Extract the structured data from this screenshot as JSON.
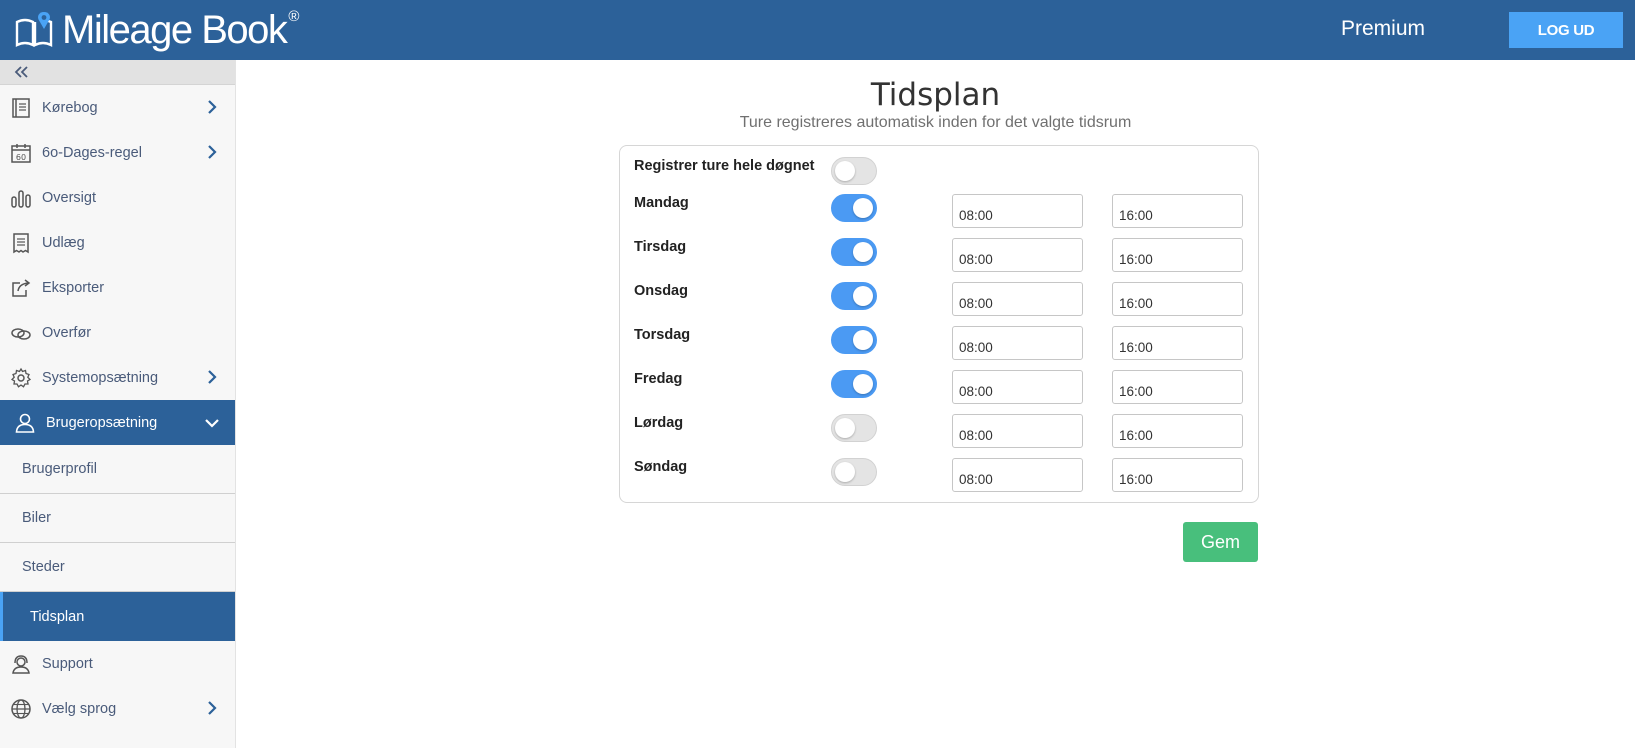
{
  "header": {
    "brand": "Mileage Book",
    "brand_mark": "®",
    "plan": "Premium",
    "logout_label": "LOG UD"
  },
  "sidebar": {
    "items": [
      {
        "label": "Kørebog",
        "icon": "book-icon",
        "chevron": "right"
      },
      {
        "label": "6o-Dages-regel",
        "icon": "calendar-60-icon",
        "chevron": "right"
      },
      {
        "label": "Oversigt",
        "icon": "bar-chart-icon"
      },
      {
        "label": "Udlæg",
        "icon": "receipt-icon"
      },
      {
        "label": "Eksporter",
        "icon": "export-icon"
      },
      {
        "label": "Overfør",
        "icon": "transfer-icon"
      },
      {
        "label": "Systemopsætning",
        "icon": "gear-icon",
        "chevron": "right"
      },
      {
        "label": "Brugeropsætning",
        "icon": "user-icon",
        "chevron": "down",
        "active": true
      }
    ],
    "sub_items": [
      {
        "label": "Brugerprofil"
      },
      {
        "label": "Biler"
      },
      {
        "label": "Steder"
      },
      {
        "label": "Tidsplan",
        "active": true
      }
    ],
    "bottom_items": [
      {
        "label": "Support",
        "icon": "support-icon"
      },
      {
        "label": "Vælg sprog",
        "icon": "globe-icon",
        "chevron": "right"
      }
    ]
  },
  "main": {
    "title": "Tidsplan",
    "subtitle": "Ture registreres automatisk inden for det valgte tidsrum",
    "all_day": {
      "label": "Registrer ture hele døgnet",
      "enabled": false
    },
    "days": [
      {
        "label": "Mandag",
        "enabled": true,
        "from": "08:00",
        "to": "16:00"
      },
      {
        "label": "Tirsdag",
        "enabled": true,
        "from": "08:00",
        "to": "16:00"
      },
      {
        "label": "Onsdag",
        "enabled": true,
        "from": "08:00",
        "to": "16:00"
      },
      {
        "label": "Torsdag",
        "enabled": true,
        "from": "08:00",
        "to": "16:00"
      },
      {
        "label": "Fredag",
        "enabled": true,
        "from": "08:00",
        "to": "16:00"
      },
      {
        "label": "Lørdag",
        "enabled": false,
        "from": "08:00",
        "to": "16:00"
      },
      {
        "label": "Søndag",
        "enabled": false,
        "from": "08:00",
        "to": "16:00"
      }
    ],
    "save_label": "Gem"
  },
  "colors": {
    "header": "#2c6199",
    "logout": "#4aa3f5",
    "toggle_on": "#4b9af3",
    "save": "#48bf7c"
  }
}
